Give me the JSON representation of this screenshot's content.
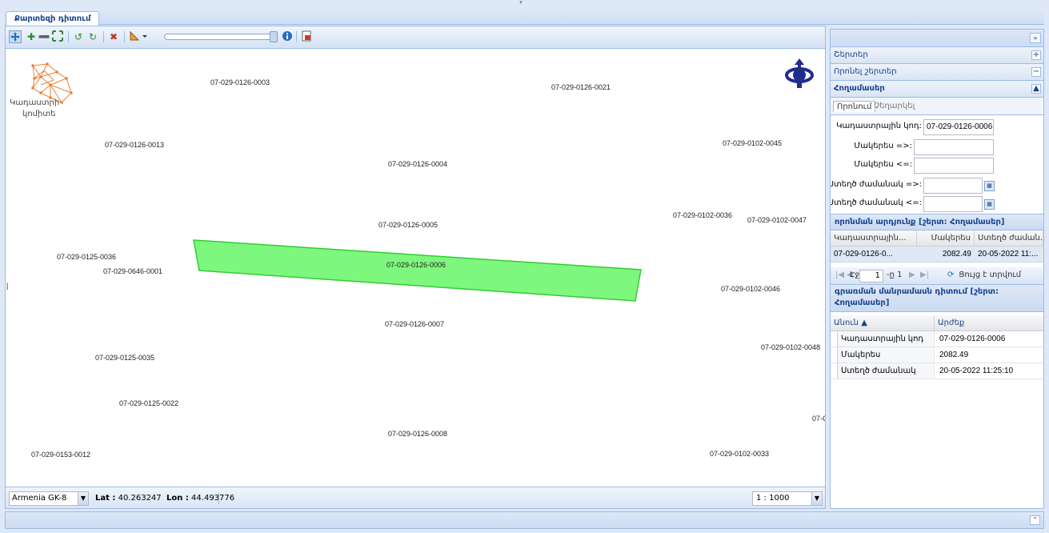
{
  "tab": {
    "label": "Քարտեզի դիտում"
  },
  "toolbar": {
    "buttons": [
      {
        "icon": "pan-icon"
      },
      {
        "icon": "zoom-in-icon"
      },
      {
        "icon": "zoom-out-icon"
      },
      {
        "icon": "zoom-extent-icon"
      },
      {
        "icon": "history-back-icon"
      },
      {
        "icon": "history-forward-icon"
      },
      {
        "icon": "clear-selection-icon"
      },
      {
        "icon": "measure-icon"
      },
      {
        "icon": "info-icon"
      },
      {
        "icon": "print-icon"
      }
    ]
  },
  "logo": {
    "line1": "Կադաստրի",
    "line2": "կոմիտե"
  },
  "parcels": [
    {
      "label": "07-029-0126-0003"
    },
    {
      "label": "07-029-0126-0021"
    },
    {
      "label": "07-029-0126-0013"
    },
    {
      "label": "07-029-0102-0045"
    },
    {
      "label": "07-029-0126-0004"
    },
    {
      "label": "07-029-0102-0036"
    },
    {
      "label": "07-029-0102-0047"
    },
    {
      "label": "07-029-0126-0005"
    },
    {
      "label": "07-029-0125-0036"
    },
    {
      "label": "07-029-0646-0001"
    },
    {
      "label": "07-029-0126-0006"
    },
    {
      "label": "07-029-0102-0046"
    },
    {
      "label": "07-029-0126-0007"
    },
    {
      "label": "07-029-0102-0048"
    },
    {
      "label": "07-029-0125-0035"
    },
    {
      "label": "07-029-0125-0022"
    },
    {
      "label": "07-C"
    },
    {
      "label": "07-029-0126-0008"
    },
    {
      "label": "07-029-0153-0012"
    },
    {
      "label": "07-029-0102-0033"
    }
  ],
  "statusbar": {
    "projection": "Armenia GK-8",
    "lat_label": "Lat :",
    "lat_value": "40.263247",
    "lon_label": "Lon :",
    "lon_value": "44.493776",
    "scale": "1 : 1000"
  },
  "right_panel": {
    "accordion": [
      {
        "label": "Շերտեր",
        "toggle": "+"
      },
      {
        "label": "Որոնել շերտեր",
        "toggle": "−"
      },
      {
        "label": "Հողամասեր",
        "toggle": "▲"
      }
    ],
    "subtabs": [
      "Որոնում",
      "Չեղարկել"
    ],
    "form": {
      "cadastral_label": "Կադաստրային կոդ:",
      "cadastral_value": "07-029-0126-0006",
      "area_min_label": "Մակերես =>:",
      "area_max_label": "Մակերես <=:",
      "created_from_label": "Ստեղծ ժամանակ =>:",
      "created_to_label": "Ստեղծ ժամանակ <=:"
    },
    "results": {
      "title": "որոնման արդյունք [շերտ: Հողամասեր]",
      "columns": [
        "Կադաստրային...",
        "Մակերես",
        "Ստեղծ ժաման..."
      ],
      "rows": [
        [
          "07-029-0126-0...",
          "2082.49",
          "20-05-2022 11:..."
        ]
      ]
    },
    "pager": {
      "page_label": "Էջ",
      "page_value": "1",
      "of_label": "-ը 1",
      "refresh_label": "Ցույց է տրվում"
    },
    "details": {
      "title": "գրառման մանրամասն դիտում [շերտ: Հողամասեր]",
      "col_name": "Անուն ▲",
      "col_value": "Արժեք",
      "rows": [
        {
          "name": "Կադաստրային կոդ",
          "value": "07-029-0126-0006"
        },
        {
          "name": "Մակերես",
          "value": "2082.49"
        },
        {
          "name": "Ստեղծ ժամանակ",
          "value": "20-05-2022 11:25:10"
        }
      ]
    }
  },
  "colors": {
    "selected_parcel_fill": "#7ef77e",
    "selected_parcel_stroke": "#33cc33",
    "header_text": "#15428b",
    "panel_border": "#99bbe8"
  }
}
